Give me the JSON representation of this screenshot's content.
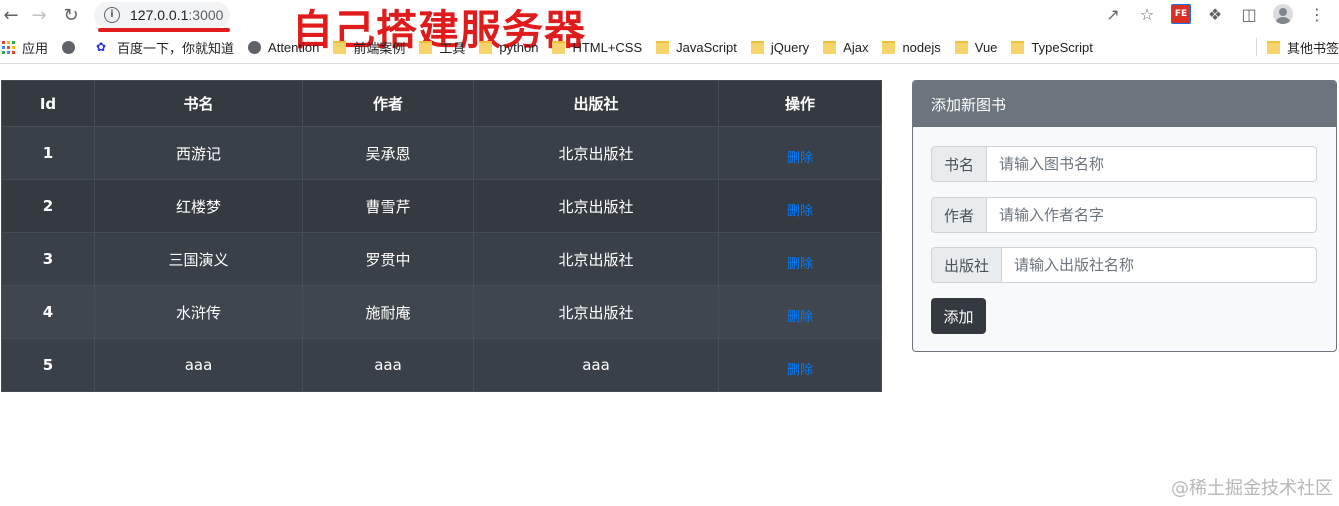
{
  "browser": {
    "url_host": "127.0.0.1",
    "url_port": ":3000",
    "overlay_title": "自己搭建服务器",
    "fe_badge": "FE"
  },
  "bookmarks": [
    {
      "label": "应用",
      "icon": "apps-icon"
    },
    {
      "label": "",
      "icon": "globe-icon"
    },
    {
      "label": "百度一下，你就知道",
      "icon": "baidu-paw-icon"
    },
    {
      "label": "Attention",
      "icon": "globe-icon"
    },
    {
      "label": "前端案例",
      "icon": "folder-icon"
    },
    {
      "label": "工具",
      "icon": "folder-icon"
    },
    {
      "label": "python",
      "icon": "folder-icon"
    },
    {
      "label": "HTML+CSS",
      "icon": "folder-icon"
    },
    {
      "label": "JavaScript",
      "icon": "folder-icon"
    },
    {
      "label": "jQuery",
      "icon": "folder-icon"
    },
    {
      "label": "Ajax",
      "icon": "folder-icon"
    },
    {
      "label": "nodejs",
      "icon": "folder-icon"
    },
    {
      "label": "Vue",
      "icon": "folder-icon"
    },
    {
      "label": "TypeScript",
      "icon": "folder-icon"
    }
  ],
  "other_bookmarks": "其他书签",
  "table": {
    "headers": [
      "Id",
      "书名",
      "作者",
      "出版社",
      "操作"
    ],
    "rows": [
      {
        "id": "1",
        "name": "西游记",
        "author": "吴承恩",
        "publisher": "北京出版社",
        "action": "删除"
      },
      {
        "id": "2",
        "name": "红楼梦",
        "author": "曹雪芹",
        "publisher": "北京出版社",
        "action": "删除"
      },
      {
        "id": "3",
        "name": "三国演义",
        "author": "罗贯中",
        "publisher": "北京出版社",
        "action": "删除"
      },
      {
        "id": "4",
        "name": "水浒传",
        "author": "施耐庵",
        "publisher": "北京出版社",
        "action": "删除"
      },
      {
        "id": "5",
        "name": "aaa",
        "author": "aaa",
        "publisher": "aaa",
        "action": "删除"
      }
    ]
  },
  "form": {
    "title": "添加新图书",
    "book_label": "书名",
    "book_placeholder": "请输入图书名称",
    "author_label": "作者",
    "author_placeholder": "请输入作者名字",
    "publisher_label": "出版社",
    "publisher_placeholder": "请输入出版社名称",
    "submit_label": "添加"
  },
  "watermark": "@稀土掘金技术社区",
  "colors": {
    "overlay_red": "#e01b1b",
    "table_dark": "#343a40",
    "link_blue": "#007bff",
    "card_header": "#6c757d"
  }
}
